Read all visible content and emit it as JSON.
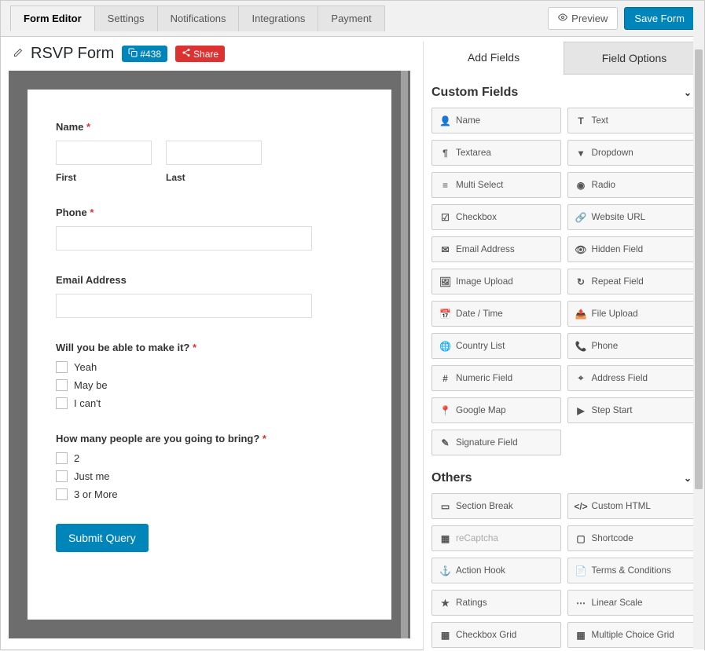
{
  "tabs": {
    "form_editor": "Form Editor",
    "settings": "Settings",
    "notifications": "Notifications",
    "integrations": "Integrations",
    "payment": "Payment"
  },
  "actions": {
    "preview": "Preview",
    "save": "Save Form"
  },
  "form": {
    "title": "RSVP Form",
    "id_label": "#438",
    "share": "Share"
  },
  "fields": {
    "name": {
      "label": "Name",
      "first": "First",
      "last": "Last"
    },
    "phone": {
      "label": "Phone"
    },
    "email": {
      "label": "Email Address"
    },
    "attend": {
      "label": "Will you be able to make it?",
      "opts": [
        "Yeah",
        "May be",
        "I can't"
      ]
    },
    "count": {
      "label": "How many people are you going to bring?",
      "opts": [
        "2",
        "Just me",
        "3 or More"
      ]
    },
    "submit": "Submit Query"
  },
  "panel": {
    "tab_add": "Add Fields",
    "tab_opts": "Field Options",
    "section_custom": "Custom Fields",
    "section_others": "Others",
    "custom_fields": [
      {
        "icon": "user",
        "label": "Name"
      },
      {
        "icon": "text",
        "label": "Text"
      },
      {
        "icon": "para",
        "label": "Textarea"
      },
      {
        "icon": "drop",
        "label": "Dropdown"
      },
      {
        "icon": "list",
        "label": "Multi Select"
      },
      {
        "icon": "radio",
        "label": "Radio"
      },
      {
        "icon": "check",
        "label": "Checkbox"
      },
      {
        "icon": "link",
        "label": "Website URL"
      },
      {
        "icon": "mail",
        "label": "Email Address"
      },
      {
        "icon": "eyeoff",
        "label": "Hidden Field"
      },
      {
        "icon": "image",
        "label": "Image Upload"
      },
      {
        "icon": "repeat",
        "label": "Repeat Field"
      },
      {
        "icon": "cal",
        "label": "Date / Time"
      },
      {
        "icon": "upload",
        "label": "File Upload"
      },
      {
        "icon": "globe",
        "label": "Country List"
      },
      {
        "icon": "phone",
        "label": "Phone"
      },
      {
        "icon": "hash",
        "label": "Numeric Field"
      },
      {
        "icon": "addr",
        "label": "Address Field"
      },
      {
        "icon": "pin",
        "label": "Google Map"
      },
      {
        "icon": "step",
        "label": "Step Start"
      },
      {
        "icon": "sig",
        "label": "Signature Field"
      }
    ],
    "other_fields": [
      {
        "icon": "sect",
        "label": "Section Break"
      },
      {
        "icon": "code",
        "label": "Custom HTML"
      },
      {
        "icon": "recap",
        "label": "reCaptcha",
        "disabled": true
      },
      {
        "icon": "short",
        "label": "Shortcode"
      },
      {
        "icon": "anchor",
        "label": "Action Hook"
      },
      {
        "icon": "terms",
        "label": "Terms & Conditions"
      },
      {
        "icon": "star",
        "label": "Ratings"
      },
      {
        "icon": "scale",
        "label": "Linear Scale"
      },
      {
        "icon": "cgrid",
        "label": "Checkbox Grid"
      },
      {
        "icon": "mgrid",
        "label": "Multiple Choice Grid"
      }
    ]
  },
  "icons": {
    "user": "👤",
    "text": "T",
    "para": "¶",
    "drop": "▾",
    "list": "≡",
    "radio": "◉",
    "check": "☑",
    "link": "🔗",
    "mail": "✉",
    "eyeoff": "👁",
    "image": "🖼",
    "repeat": "↻",
    "cal": "📅",
    "upload": "📤",
    "globe": "🌐",
    "phone": "📞",
    "hash": "#",
    "addr": "⌖",
    "pin": "📍",
    "step": "▶",
    "sig": "✎",
    "sect": "▭",
    "code": "</>",
    "recap": "▦",
    "short": "▢",
    "anchor": "⚓",
    "terms": "📄",
    "star": "★",
    "scale": "⋯",
    "cgrid": "▦",
    "mgrid": "▦"
  }
}
